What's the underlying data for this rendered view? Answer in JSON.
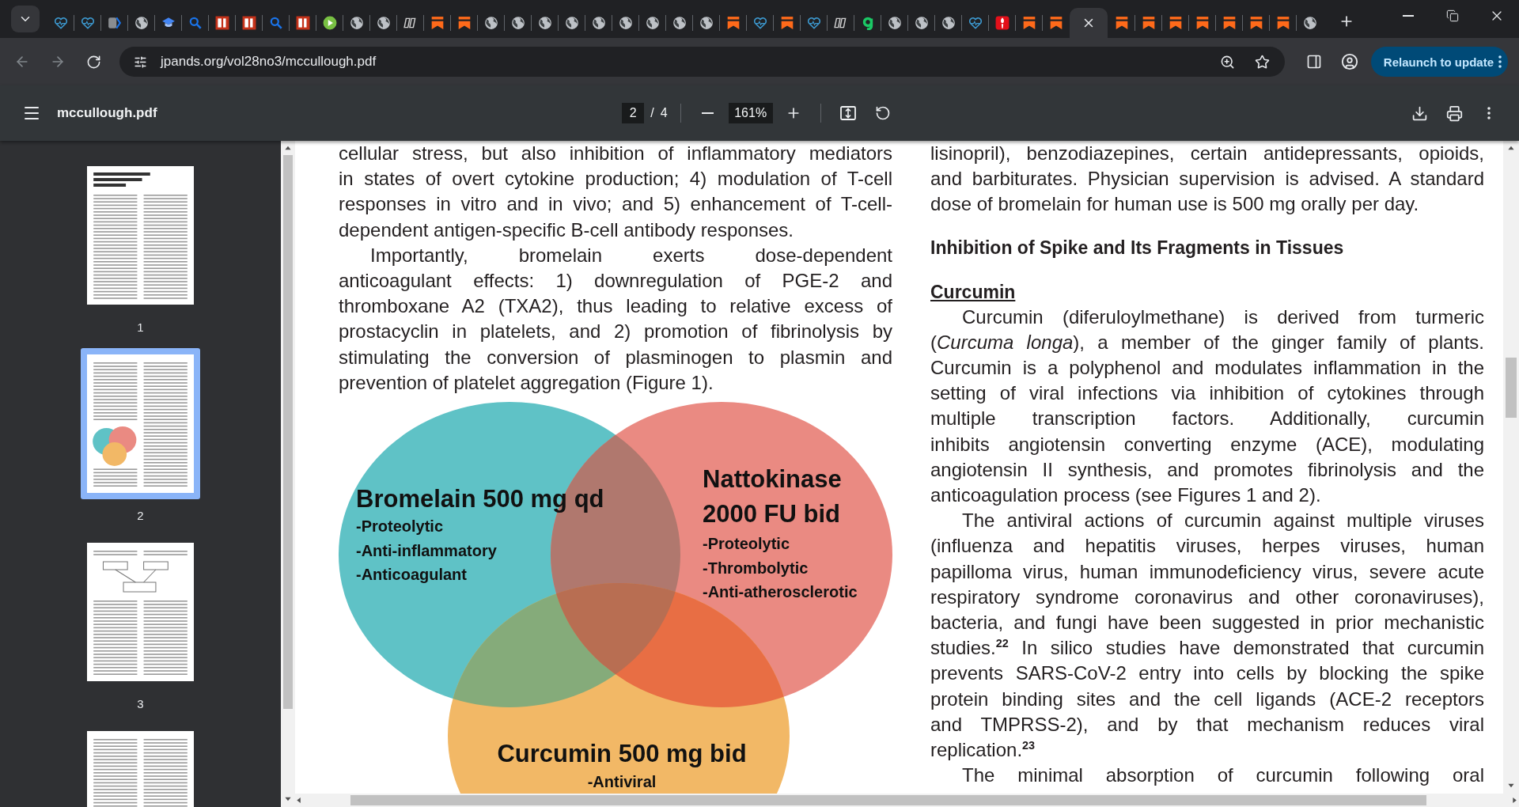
{
  "tabs": [
    {
      "kind": "heart",
      "selected": false
    },
    {
      "kind": "heart",
      "selected": false
    },
    {
      "kind": "chevron",
      "selected": false
    },
    {
      "kind": "globe",
      "selected": false
    },
    {
      "kind": "cap",
      "selected": false
    },
    {
      "kind": "search",
      "selected": false
    },
    {
      "kind": "bi",
      "selected": false
    },
    {
      "kind": "bi",
      "selected": false
    },
    {
      "kind": "search",
      "selected": false
    },
    {
      "kind": "bi",
      "selected": false
    },
    {
      "kind": "play",
      "selected": false
    },
    {
      "kind": "globe",
      "selected": false
    },
    {
      "kind": "globe",
      "selected": false
    },
    {
      "kind": "dr",
      "selected": false
    },
    {
      "kind": "bookmark",
      "selected": false
    },
    {
      "kind": "bookmark",
      "selected": false
    },
    {
      "kind": "globe",
      "selected": false
    },
    {
      "kind": "globe",
      "selected": false
    },
    {
      "kind": "globe",
      "selected": false
    },
    {
      "kind": "globe",
      "selected": false
    },
    {
      "kind": "globe",
      "selected": false
    },
    {
      "kind": "globe",
      "selected": false
    },
    {
      "kind": "globe",
      "selected": false
    },
    {
      "kind": "globe",
      "selected": false
    },
    {
      "kind": "globe",
      "selected": false
    },
    {
      "kind": "bookmark",
      "selected": false
    },
    {
      "kind": "heart",
      "selected": false
    },
    {
      "kind": "bookmark",
      "selected": false
    },
    {
      "kind": "heart",
      "selected": false
    },
    {
      "kind": "dr",
      "selected": false
    },
    {
      "kind": "g",
      "selected": false
    },
    {
      "kind": "globe",
      "selected": false
    },
    {
      "kind": "globe",
      "selected": false
    },
    {
      "kind": "globe",
      "selected": false
    },
    {
      "kind": "heart",
      "selected": false
    },
    {
      "kind": "torch",
      "selected": false
    },
    {
      "kind": "bookmark",
      "selected": false
    },
    {
      "kind": "bookmark",
      "selected": false
    },
    {
      "selected": true
    },
    {
      "kind": "bookmark",
      "selected": false
    },
    {
      "kind": "bookmark",
      "selected": false
    },
    {
      "kind": "bookmark",
      "selected": false
    },
    {
      "kind": "bookmark",
      "selected": false
    },
    {
      "kind": "bookmark",
      "selected": false
    },
    {
      "kind": "bookmark",
      "selected": false
    },
    {
      "kind": "bookmark",
      "selected": false
    },
    {
      "kind": "globe",
      "selected": false
    }
  ],
  "toolbar": {
    "url": "jpands.org/vol28no3/mccullough.pdf",
    "relaunch_label": "Relaunch to update"
  },
  "pdf_toolbar": {
    "file_name": "mccullough.pdf",
    "page": "2",
    "page_separator": "/",
    "page_count": "4",
    "zoom": "161%"
  },
  "thumbnails": [
    {
      "kind": "title",
      "label": "1",
      "selected": false
    },
    {
      "kind": "figure",
      "label": "2",
      "selected": true
    },
    {
      "kind": "diagram",
      "label": "3",
      "selected": false
    },
    {
      "kind": "text",
      "selected": false
    }
  ],
  "document": {
    "left_column": [
      {
        "kind": "paragraph",
        "indented": false,
        "continues": false,
        "lines": [
          "cellular stress, but also inhibition of inflammatory mediators",
          "in states of overt cytokine production; 4) modulation of T-cell",
          "responses in vitro and in vivo; and 5) enhancement of T-cell-",
          "dependent antigen-specific B-cell antibody responses."
        ]
      },
      {
        "kind": "paragraph",
        "indented": true,
        "continues": false,
        "lines": [
          "Importantly, bromelain exerts dose-dependent",
          "anticoagulant effects: 1) downregulation of PGE-2 and",
          "thromboxane A2 (TXA2), thus leading to relative excess of",
          "prostacyclin in platelets, and 2) promotion of fibrinolysis by",
          "stimulating the conversion of plasminogen to plasmin and",
          "prevention of platelet aggregation (Figure 1)."
        ]
      }
    ],
    "figure": {
      "circles": [
        {
          "color": "#5fc2c6",
          "title_lines": [
            "Bromelain 500 mg qd"
          ],
          "items": [
            "-Proteolytic",
            "-Anti-inflammatory",
            "-Anticoagulant"
          ]
        },
        {
          "color": "#ea8a82",
          "title_lines": [
            "Nattokinase",
            "2000 FU bid"
          ],
          "items": [
            "-Proteolytic",
            "-Thrombolytic",
            "-Anti-atherosclerotic"
          ]
        },
        {
          "color": "#f2b866",
          "title_lines": [
            "Curcumin 500 mg bid"
          ],
          "items": [
            "-Antiviral"
          ]
        }
      ]
    },
    "right_column": [
      {
        "kind": "paragraph",
        "indented": false,
        "continues": false,
        "lines": [
          "lisinopril), benzodiazepines, certain antidepressants, opioids,",
          "and barbiturates. Physician supervision is advised. A standard",
          "dose of bromelain for human use is 500 mg orally per day."
        ]
      },
      {
        "kind": "heading",
        "text": "Inhibition of Spike and Its Fragments in Tissues"
      },
      {
        "kind": "subheading",
        "text": "Curcumin"
      },
      {
        "kind": "paragraph",
        "indented": true,
        "continues": false,
        "lines": [
          "Curcumin (diferuloylmethane) is derived from turmeric",
          "(*Curcuma longa*), a member of the ginger family of plants.",
          "Curcumin is a polyphenol and modulates inflammation in the",
          "setting of viral infections via inhibition of cytokines through",
          "multiple transcription factors. Additionally, curcumin",
          "inhibits angiotensin converting enzyme (ACE), modulating",
          "angiotensin II synthesis, and promotes fibrinolysis and the",
          "anticoagulation process (see Figures 1 and 2)."
        ]
      },
      {
        "kind": "paragraph",
        "indented": true,
        "continues": false,
        "lines": [
          "The antiviral actions of curcumin against multiple viruses",
          "(influenza and hepatitis viruses, herpes viruses, human",
          "papilloma virus, human immunodeficiency virus, severe acute",
          "respiratory syndrome coronavirus and other coronaviruses),",
          "bacteria, and fungi have been suggested in prior mechanistic",
          "studies.$^{22}$ In silico studies have demonstrated that curcumin",
          "prevents SARS-CoV-2 entry into cells by blocking the spike",
          "protein binding sites and the cell ligands (ACE-2 receptors",
          "and TMPRSS-2), and by that mechanism reduces viral",
          "replication.$^{23}$"
        ]
      },
      {
        "kind": "paragraph",
        "indented": true,
        "continues": true,
        "lines": [
          "The minimal absorption of curcumin following oral"
        ]
      }
    ]
  }
}
